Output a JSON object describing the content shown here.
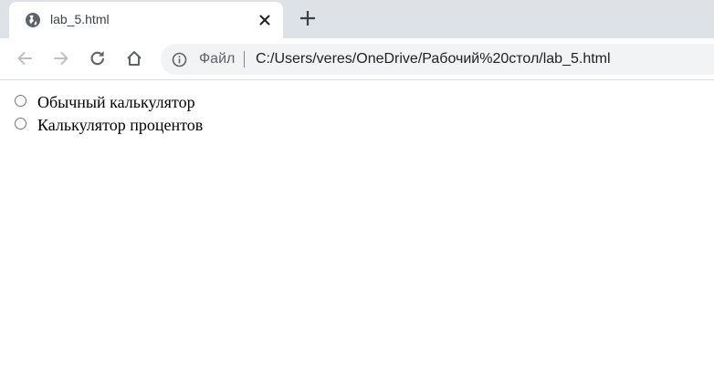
{
  "tab": {
    "title": "lab_5.html",
    "favicon": "globe-icon",
    "close_icon": "close-icon"
  },
  "new_tab_icon": "plus-icon",
  "toolbar": {
    "back_icon": "arrow-left-icon",
    "forward_icon": "arrow-right-icon",
    "reload_icon": "reload-icon",
    "home_icon": "home-icon"
  },
  "omnibox": {
    "info_icon": "info-icon",
    "security_label": "Файл",
    "url": "C:/Users/veres/OneDrive/Рабочий%20стол/lab_5.html"
  },
  "page": {
    "options": [
      {
        "label": "Обычный калькулятор",
        "checked": false
      },
      {
        "label": "Калькулятор процентов",
        "checked": false
      }
    ]
  },
  "colors": {
    "tabstrip_bg": "#dee1e6",
    "omnibox_bg": "#f1f3f4",
    "icon_color": "#5f6368",
    "icon_disabled": "#bdc1c6"
  }
}
